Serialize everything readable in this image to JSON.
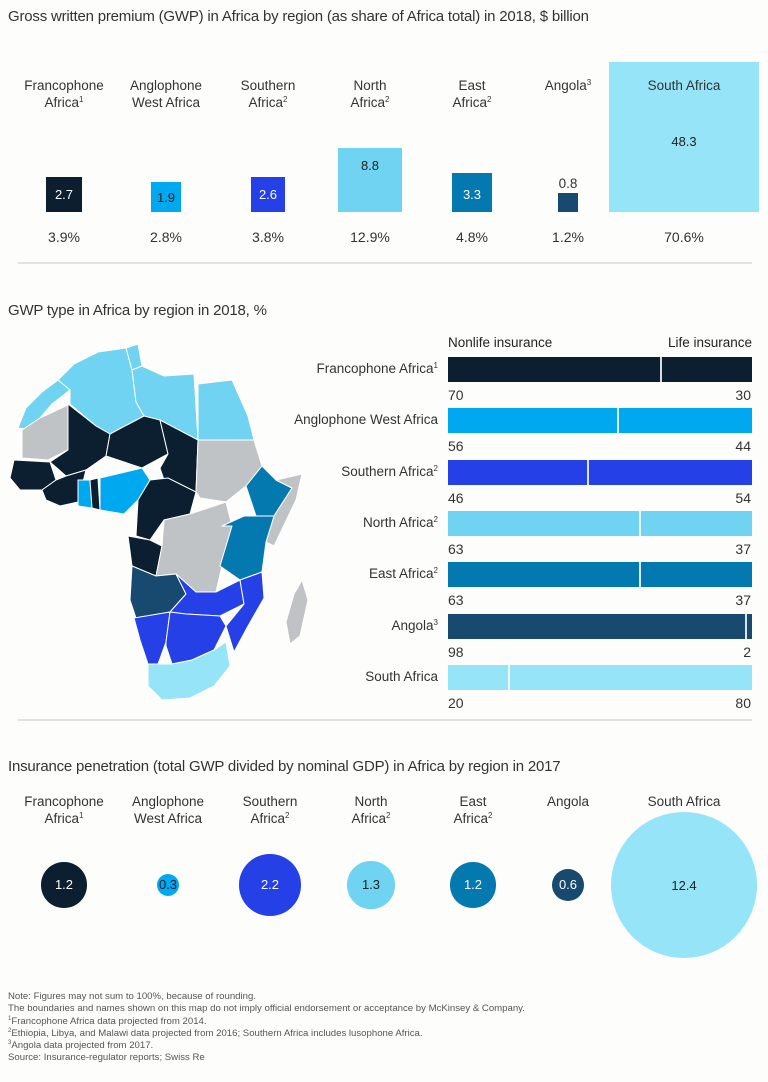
{
  "colors": {
    "francophone": "#0b1f30",
    "anglophone_west": "#00a8f0",
    "southern": "#2540e6",
    "north": "#6fd3f1",
    "east": "#0479b0",
    "angola": "#174a6e",
    "south_africa": "#96e4f8",
    "other": "#c0c3c6"
  },
  "chart_data": [
    {
      "type": "bar",
      "subtype": "proportional-squares",
      "title": "Gross written premium (GWP) in Africa by region (as share of Africa total) in 2018, $ billion",
      "categories": [
        {
          "name": "Francophone",
          "name2": "Africa",
          "sup": "1"
        },
        {
          "name": "Anglophone",
          "name2": "West Africa",
          "sup": ""
        },
        {
          "name": "Southern",
          "name2": "Africa",
          "sup": "2"
        },
        {
          "name": "North",
          "name2": "Africa",
          "sup": "2"
        },
        {
          "name": "East",
          "name2": "Africa",
          "sup": "2"
        },
        {
          "name": "Angola",
          "name2": "",
          "sup": "3"
        },
        {
          "name": "South Africa",
          "name2": "",
          "sup": ""
        }
      ],
      "values": [
        2.7,
        1.9,
        2.6,
        8.8,
        3.3,
        0.8,
        48.3
      ],
      "value_labels": [
        "2.7",
        "1.9",
        "2.6",
        "8.8",
        "3.3",
        "0.8",
        "48.3"
      ],
      "share_labels": [
        "3.9%",
        "2.8%",
        "3.8%",
        "12.9%",
        "4.8%",
        "1.2%",
        "70.6%"
      ],
      "shares": [
        3.9,
        2.8,
        3.8,
        12.9,
        4.8,
        1.2,
        70.6
      ]
    },
    {
      "type": "bar",
      "subtype": "stacked-100-horizontal",
      "title": "GWP type in Africa by region in 2018, %",
      "series_labels": [
        "Nonlife insurance",
        "Life insurance"
      ],
      "categories": [
        {
          "name": "Francophone Africa",
          "sup": "1"
        },
        {
          "name": "Anglophone West Africa",
          "sup": ""
        },
        {
          "name": "Southern Africa",
          "sup": "2"
        },
        {
          "name": "North Africa",
          "sup": "2"
        },
        {
          "name": "East Africa",
          "sup": "2"
        },
        {
          "name": "Angola",
          "sup": "3"
        },
        {
          "name": "South Africa",
          "sup": ""
        }
      ],
      "series": [
        {
          "name": "Nonlife insurance",
          "values": [
            70,
            56,
            46,
            63,
            63,
            98,
            20
          ]
        },
        {
          "name": "Life insurance",
          "values": [
            30,
            44,
            54,
            37,
            37,
            2,
            80
          ]
        }
      ],
      "nonlife_labels": [
        "70",
        "56",
        "46",
        "63",
        "63",
        "98",
        "20"
      ],
      "life_labels": [
        "30",
        "44",
        "54",
        "37",
        "37",
        "2",
        "80"
      ]
    },
    {
      "type": "scatter",
      "subtype": "bubble",
      "title": "Insurance penetration (total GWP divided by nominal GDP) in Africa by region in 2017",
      "categories": [
        {
          "name": "Francophone",
          "name2": "Africa",
          "sup": "1"
        },
        {
          "name": "Anglophone",
          "name2": "West Africa",
          "sup": ""
        },
        {
          "name": "Southern",
          "name2": "Africa",
          "sup": "2"
        },
        {
          "name": "North",
          "name2": "Africa",
          "sup": "2"
        },
        {
          "name": "East",
          "name2": "Africa",
          "sup": "2"
        },
        {
          "name": "Angola",
          "name2": "",
          "sup": ""
        },
        {
          "name": "South Africa",
          "name2": "",
          "sup": ""
        }
      ],
      "values": [
        1.2,
        0.3,
        2.2,
        1.3,
        1.2,
        0.6,
        12.4
      ],
      "value_labels": [
        "1.2",
        "0.3",
        "2.2",
        "1.3",
        "1.2",
        "0.6",
        "12.4"
      ]
    }
  ],
  "map": {
    "description": "Map of Africa colored by region",
    "legend_by_color": [
      "francophone",
      "anglophone_west",
      "southern",
      "north",
      "east",
      "angola",
      "south_africa",
      "other"
    ]
  },
  "notes": [
    {
      "sup": "",
      "text": "Note: Figures may not sum to 100%, because of rounding."
    },
    {
      "sup": "",
      "text": "The boundaries and names shown on this map do not imply official endorsement or acceptance by McKinsey & Company."
    },
    {
      "sup": "1",
      "text": "Francophone Africa data projected from 2014."
    },
    {
      "sup": "2",
      "text": "Ethiopia, Libya, and Malawi data projected from 2016; Southern Africa includes lusophone Africa."
    },
    {
      "sup": "3",
      "text": "Angola data projected from 2017."
    },
    {
      "sup": "",
      "text": "Source: Insurance-regulator reports; Swiss Re"
    }
  ]
}
